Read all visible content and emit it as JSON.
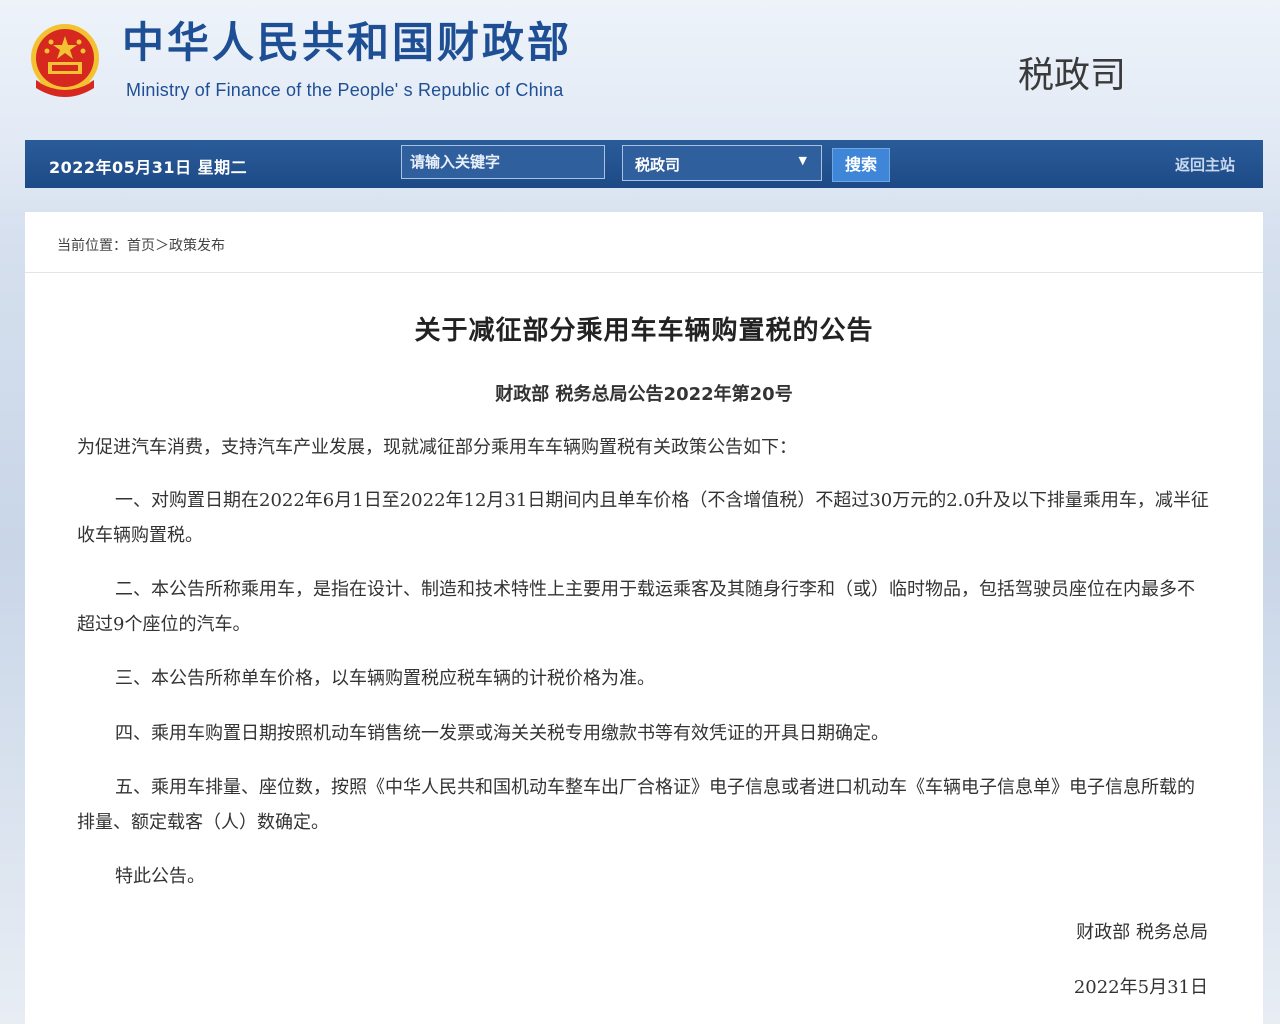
{
  "header": {
    "site_title": "中华人民共和国财政部",
    "site_subtitle": "Ministry of Finance of the People' s Republic of China",
    "department": "税政司"
  },
  "navbar": {
    "date": "2022年05月31日 星期二",
    "search_placeholder": "请输入关键字",
    "select_value": "税政司",
    "search_label": "搜索",
    "home_link": "返回主站"
  },
  "breadcrumb": "当前位置：首页＞政策发布",
  "article": {
    "title": "关于减征部分乘用车车辆购置税的公告",
    "doc_number": "财政部 税务总局公告2022年第20号",
    "intro": "为促进汽车消费，支持汽车产业发展，现就减征部分乘用车车辆购置税有关政策公告如下：",
    "items": [
      "一、对购置日期在2022年6月1日至2022年12月31日期间内且单车价格（不含增值税）不超过30万元的2.0升及以下排量乘用车，减半征收车辆购置税。",
      "二、本公告所称乘用车，是指在设计、制造和技术特性上主要用于载运乘客及其随身行李和（或）临时物品，包括驾驶员座位在内最多不超过9个座位的汽车。",
      "三、本公告所称单车价格，以车辆购置税应税车辆的计税价格为准。",
      "四、乘用车购置日期按照机动车销售统一发票或海关关税专用缴款书等有效凭证的开具日期确定。",
      "五、乘用车排量、座位数，按照《中华人民共和国机动车整车出厂合格证》电子信息或者进口机动车《车辆电子信息单》电子信息所载的排量、额定载客（人）数确定。"
    ],
    "closing": "特此公告。",
    "signature": "财政部 税务总局",
    "sign_date": "2022年5月31日"
  },
  "colors": {
    "brand_blue": "#1e4f95",
    "nav_bg": "#1d4a86",
    "emblem_red": "#d6281f",
    "emblem_gold": "#f3c233"
  }
}
